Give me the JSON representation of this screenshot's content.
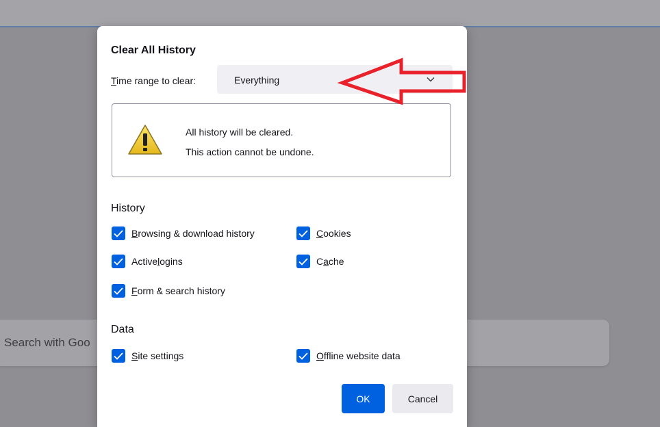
{
  "background": {
    "search_placeholder": "Search with Goo"
  },
  "dialog": {
    "title": "Clear All History",
    "time_range": {
      "label_prefix": "T",
      "label_rest": "ime range to clear:",
      "selected": "Everything"
    },
    "warning": {
      "line1": "All history will be cleared.",
      "line2": "This action cannot be undone."
    },
    "history_section": {
      "heading": "History",
      "items": [
        {
          "accel": "B",
          "rest": "rowsing & download history",
          "checked": true
        },
        {
          "accel": "C",
          "rest": "ookies",
          "checked": true
        },
        {
          "pre": "Active ",
          "accel": "l",
          "rest": "ogins",
          "checked": true
        },
        {
          "pre": "C",
          "accel": "a",
          "rest": "che",
          "checked": true
        },
        {
          "accel": "F",
          "rest": "orm & search history",
          "checked": true
        }
      ]
    },
    "data_section": {
      "heading": "Data",
      "items": [
        {
          "accel": "S",
          "rest": "ite settings",
          "checked": true
        },
        {
          "accel": "O",
          "rest": "ffline website data",
          "checked": true
        }
      ]
    },
    "buttons": {
      "ok": "OK",
      "cancel": "Cancel"
    }
  },
  "colors": {
    "accent": "#0061e0",
    "annotation_arrow": "#e8212b",
    "overlay": "#8f8e93"
  }
}
